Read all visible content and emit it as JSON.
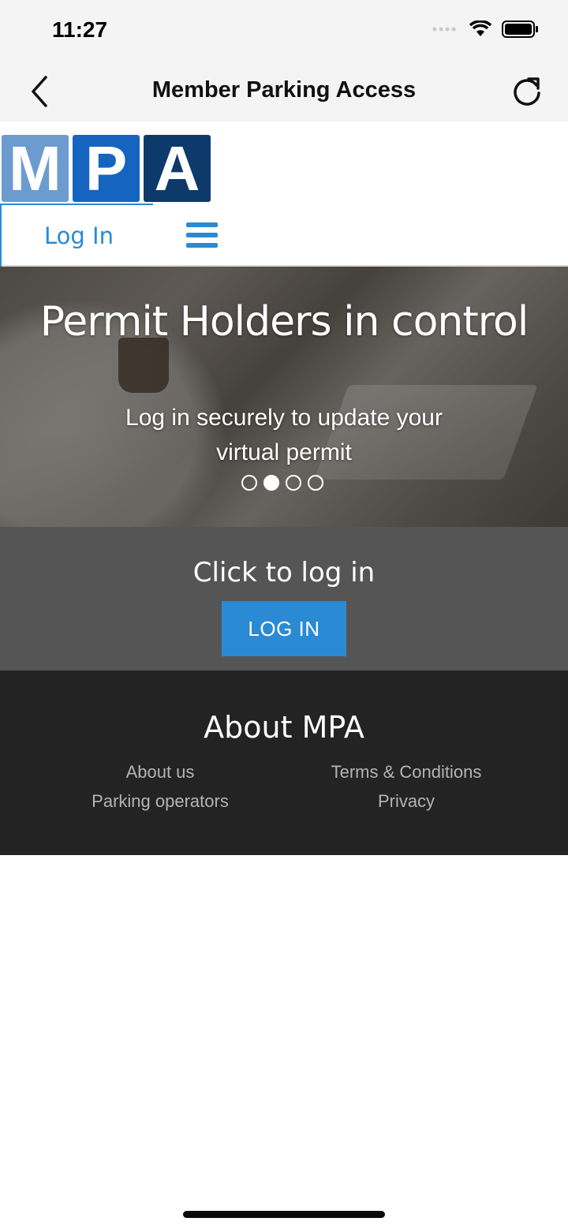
{
  "status_bar": {
    "time": "11:27"
  },
  "nav": {
    "title": "Member Parking Access"
  },
  "header": {
    "logo": {
      "letters": [
        "M",
        "P",
        "A"
      ],
      "colors": [
        "#6c9ccf",
        "#1565c0",
        "#0d3a6b"
      ]
    },
    "login_label": "Log In"
  },
  "hero": {
    "title": "Permit Holders in control",
    "subtitle": "Log in securely to update your virtual permit",
    "slide_count": 4,
    "active_slide": 2
  },
  "cta": {
    "text": "Click to log in",
    "button_label": "LOG IN"
  },
  "footer": {
    "title": "About MPA",
    "links": [
      "About us",
      "Terms & Conditions",
      "Parking operators",
      "Privacy"
    ]
  },
  "colors": {
    "accent": "#2a8ad4",
    "cta_bg": "#555555",
    "footer_bg": "#232323"
  }
}
